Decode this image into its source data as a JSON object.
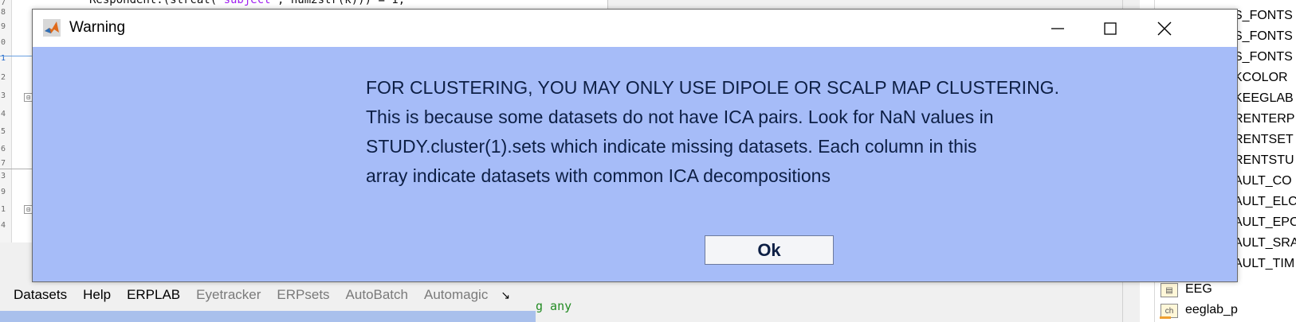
{
  "dialog": {
    "title": "Warning",
    "message_lines": [
      "FOR CLUSTERING, YOU MAY ONLY USE DIPOLE OR SCALP MAP CLUSTERING.",
      "This is because some datasets do not have ICA pairs. Look for NaN values in",
      "STUDY.cluster(1).sets which indicate missing datasets. Each column in this",
      "array indicate datasets with common ICA decompositions"
    ],
    "ok_label": "Ok",
    "controls": {
      "minimize": "minimize-icon",
      "maximize": "maximize-icon",
      "close": "close-icon"
    },
    "colors": {
      "background": "#a6bcf8",
      "titlebar": "#ffffff",
      "text": "#0d1f45"
    }
  },
  "editor": {
    "top_code": {
      "prefix": "Respondent.(strcat('",
      "string": "subject",
      "suffix": "', num2str(k))) = 1;"
    },
    "line_numbers": [
      "7",
      "8",
      "9",
      "0",
      "1",
      "2",
      "3",
      "4",
      "5",
      "6",
      "7",
      "3",
      "9",
      "1",
      "4"
    ],
    "bottom_code": "g any"
  },
  "menubar": {
    "items": [
      {
        "label": "Datasets",
        "dim": false
      },
      {
        "label": "Help",
        "dim": false
      },
      {
        "label": "ERPLAB",
        "dim": false
      },
      {
        "label": "Eyetracker",
        "dim": true
      },
      {
        "label": "ERPsets",
        "dim": true
      },
      {
        "label": "AutoBatch",
        "dim": true
      },
      {
        "label": "Automagic",
        "dim": true
      }
    ],
    "overflow_icon": "overflow-arrow-icon"
  },
  "workspace": {
    "truncated_rows": [
      "S_FONTS",
      "S_FONTS",
      "S_FONTS",
      "KCOLOR",
      "KEEGLAB",
      "RENTERP",
      "RENTSET",
      "RENTSTU",
      "AULT_CO",
      "AULT_ELC",
      "AULT_EPC",
      "AULT_SRA",
      "AULT_TIM"
    ],
    "variables": [
      {
        "icon": "struct-icon",
        "name": "EEG"
      },
      {
        "icon": "char-icon",
        "icon_text": "ch",
        "name": "eeglab_p"
      }
    ]
  }
}
